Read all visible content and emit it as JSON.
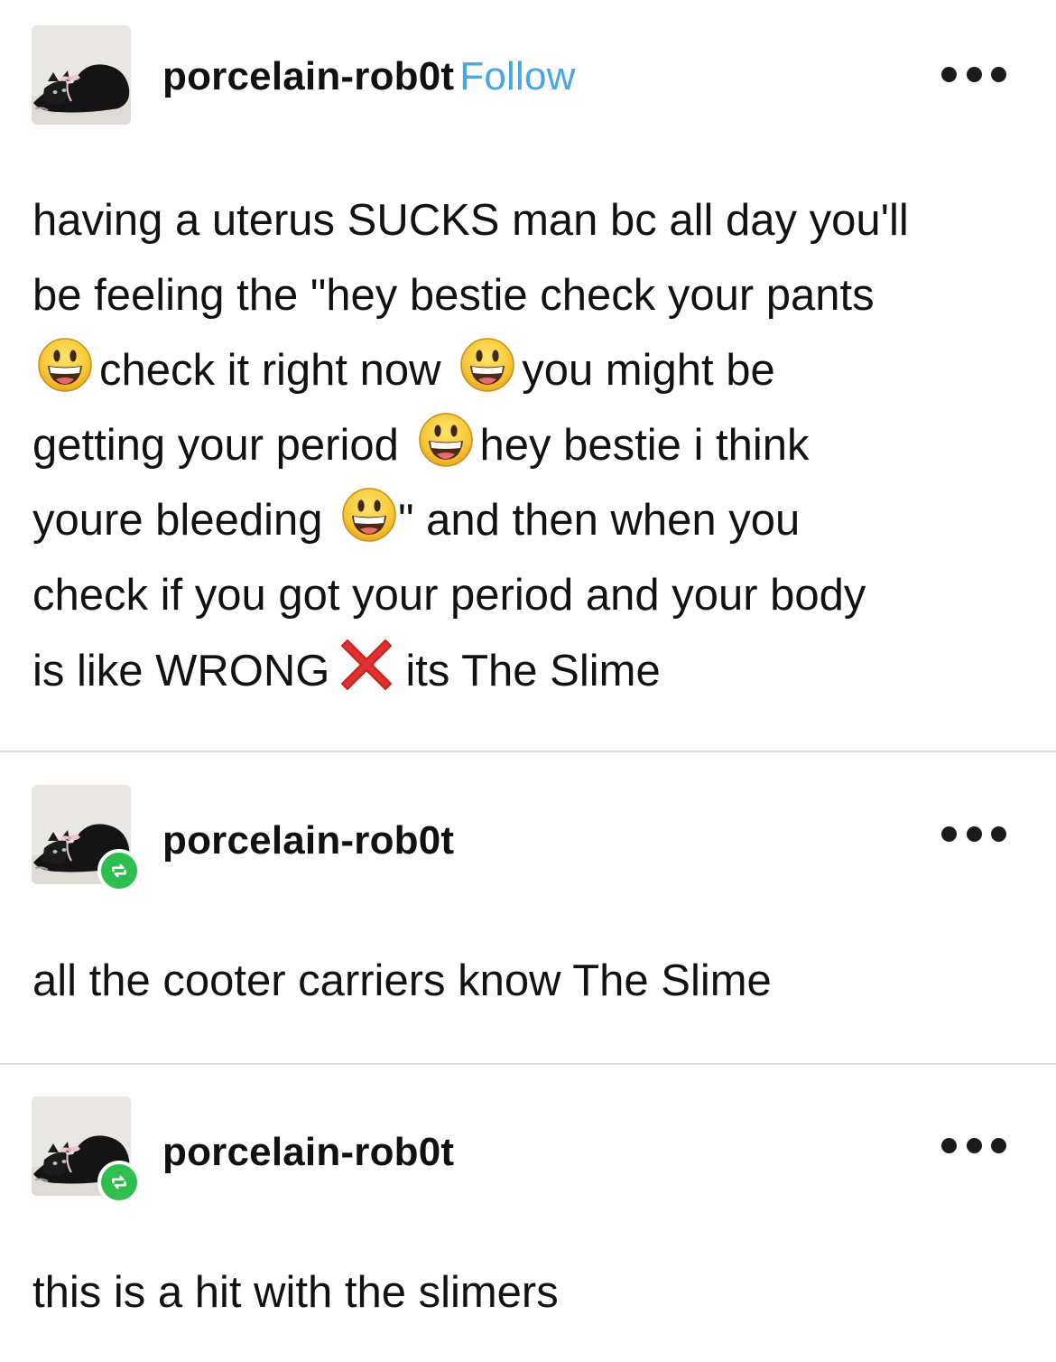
{
  "posts": [
    {
      "username": "porcelain-rob0t",
      "follow_label": "Follow",
      "reblog": false,
      "lines": [
        [
          "having a uterus SUCKS man bc all day you'll"
        ],
        [
          "be feeling the \"hey bestie check your pants"
        ],
        [
          "check it right now",
          "you might be"
        ],
        [
          "getting your period",
          "hey bestie i think"
        ],
        [
          "youre bleeding",
          "\" and then when you"
        ],
        [
          "check if you got your period and your body"
        ],
        [
          "is like WRONG",
          "its The Slime"
        ]
      ]
    },
    {
      "username": "porcelain-rob0t",
      "reblog": true,
      "text": "all the cooter carriers know The Slime"
    },
    {
      "username": "porcelain-rob0t",
      "reblog": true,
      "text": "this is a hit with the slimers"
    }
  ],
  "icons": {
    "more": "more-options-icon",
    "reblog": "reblog-icon",
    "grinning": "grinning-face-emoji",
    "cross": "cross-mark-emoji"
  },
  "colors": {
    "follow": "#49a6e6",
    "reblog_badge": "#2fbf4e",
    "divider": "#dcdcdc",
    "cross": "#e0312e"
  }
}
